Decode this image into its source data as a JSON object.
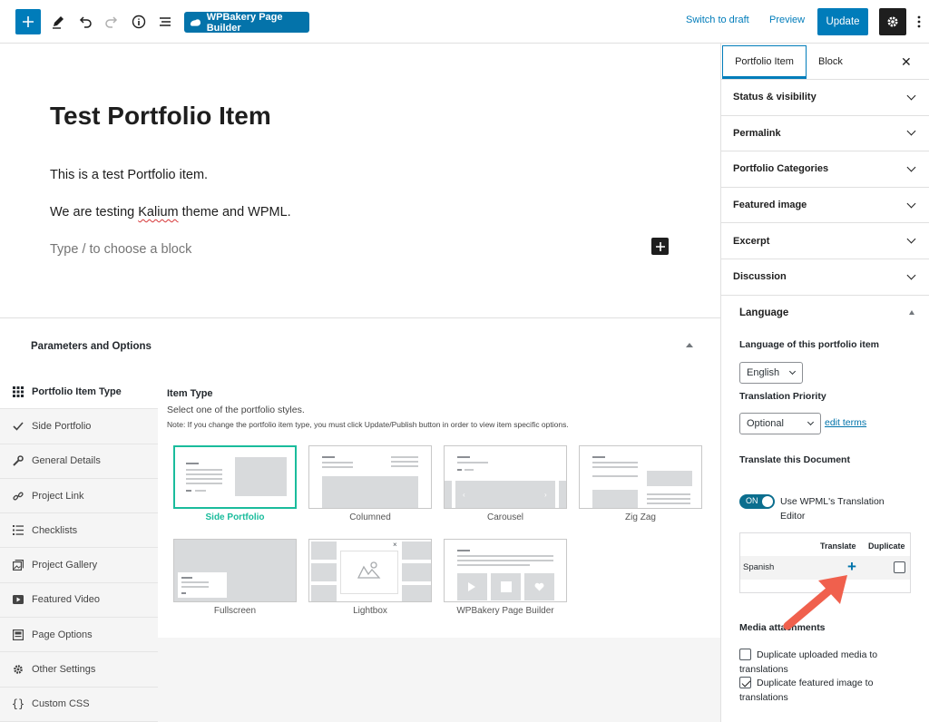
{
  "toolbar": {
    "wpbakery_label": "WPBakery Page Builder",
    "switch_to_draft": "Switch to draft",
    "preview": "Preview",
    "update": "Update"
  },
  "editor": {
    "title": "Test Portfolio Item",
    "paragraph1": "This is a test Portfolio item.",
    "paragraph2_before": "We are testing ",
    "paragraph2_word": "Kalium",
    "paragraph2_after": " theme and WPML.",
    "block_placeholder": "Type / to choose a block"
  },
  "params": {
    "heading": "Parameters and Options",
    "tabs": [
      {
        "label": "Portfolio Item Type",
        "icon": "grid-icon"
      },
      {
        "label": "Side Portfolio",
        "icon": "check-icon"
      },
      {
        "label": "General Details",
        "icon": "wrench-icon"
      },
      {
        "label": "Project Link",
        "icon": "link-icon"
      },
      {
        "label": "Checklists",
        "icon": "list-icon"
      },
      {
        "label": "Project Gallery",
        "icon": "gallery-icon"
      },
      {
        "label": "Featured Video",
        "icon": "video-icon"
      },
      {
        "label": "Page Options",
        "icon": "page-options-icon"
      },
      {
        "label": "Other Settings",
        "icon": "gear-icon"
      },
      {
        "label": "Custom CSS",
        "icon": "braces-icon"
      }
    ],
    "item_type_title": "Item Type",
    "item_type_desc": "Select one of the portfolio styles.",
    "item_type_note": "Note: If you change the portfolio item type, you must click Update/Publish button in order to view item specific options.",
    "styles": [
      "Side Portfolio",
      "Columned",
      "Carousel",
      "Zig Zag",
      "Fullscreen",
      "Lightbox",
      "WPBakery Page Builder"
    ],
    "active_style": "Side Portfolio",
    "accent_color": "#1abc9c"
  },
  "sidebar": {
    "tab_active": "Portfolio Item",
    "tab_other": "Block",
    "panels": [
      "Status & visibility",
      "Permalink",
      "Portfolio Categories",
      "Featured image",
      "Excerpt",
      "Discussion"
    ],
    "language": {
      "heading": "Language",
      "lang_label": "Language of this portfolio item",
      "lang_value": "English",
      "priority_label": "Translation Priority",
      "priority_value": "Optional",
      "edit_terms": "edit terms",
      "translate_doc": "Translate this Document",
      "toggle_state": "ON",
      "toggle_label": "Use WPML's Translation Editor",
      "col_translate": "Translate",
      "col_duplicate": "Duplicate",
      "row_language": "Spanish",
      "row_action": "+",
      "media_heading": "Media attachments",
      "dup_media": "Duplicate uploaded media to translations",
      "dup_featured": "Duplicate featured image to translations"
    }
  },
  "colors": {
    "wp_blue": "#007cba",
    "annotation_arrow": "#f0604d"
  }
}
